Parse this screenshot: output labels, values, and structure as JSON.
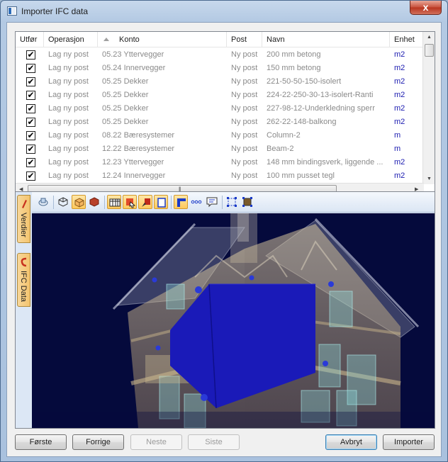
{
  "window": {
    "title": "Importer IFC data",
    "close_glyph": "x"
  },
  "grid": {
    "columns": [
      "Utfør",
      "Operasjon",
      "Konto",
      "Post",
      "Navn",
      "Enhet"
    ],
    "sorted_column": "Konto",
    "rows": [
      {
        "checked": true,
        "operasjon": "Lag ny post",
        "konto": "05.23 Yttervegger",
        "post": "Ny post",
        "navn": "200 mm betong",
        "enhet": "m2"
      },
      {
        "checked": true,
        "operasjon": "Lag ny post",
        "konto": "05.24 Innervegger",
        "post": "Ny post",
        "navn": "150 mm betong",
        "enhet": "m2"
      },
      {
        "checked": true,
        "operasjon": "Lag ny post",
        "konto": "05.25 Dekker",
        "post": "Ny post",
        "navn": "221-50-50-150-isolert",
        "enhet": "m2"
      },
      {
        "checked": true,
        "operasjon": "Lag ny post",
        "konto": "05.25 Dekker",
        "post": "Ny post",
        "navn": "224-22-250-30-13-isolert-Ranti",
        "enhet": "m2"
      },
      {
        "checked": true,
        "operasjon": "Lag ny post",
        "konto": "05.25 Dekker",
        "post": "Ny post",
        "navn": "227-98-12-Underkledning sperr",
        "enhet": "m2"
      },
      {
        "checked": true,
        "operasjon": "Lag ny post",
        "konto": "05.25 Dekker",
        "post": "Ny post",
        "navn": "262-22-148-balkong",
        "enhet": "m2"
      },
      {
        "checked": true,
        "operasjon": "Lag ny post",
        "konto": "08.22 Bæresystemer",
        "post": "Ny post",
        "navn": "Column-2",
        "enhet": "m"
      },
      {
        "checked": true,
        "operasjon": "Lag ny post",
        "konto": "12.22 Bæresystemer",
        "post": "Ny post",
        "navn": "Beam-2",
        "enhet": "m"
      },
      {
        "checked": true,
        "operasjon": "Lag ny post",
        "konto": "12.23 Yttervegger",
        "post": "Ny post",
        "navn": "148 mm bindingsverk, liggende ...",
        "enhet": "m2"
      },
      {
        "checked": true,
        "operasjon": "Lag ny post",
        "konto": "12.24 Innervegger",
        "post": "Ny post",
        "navn": "100 mm pusset tegl",
        "enhet": "m2"
      }
    ]
  },
  "viewer": {
    "side_tabs": [
      "Verdier",
      "IFC Data"
    ],
    "toolbar_icons": [
      "orbit-icon",
      "wireframe-icon",
      "transparent-icon",
      "solid-icon",
      "table-icon",
      "select-icon",
      "paint-icon",
      "frame-icon",
      "corner-icon",
      "dots-icon",
      "comment-icon",
      "select-region-icon",
      "fit-icon"
    ]
  },
  "buttons": {
    "forste": "Første",
    "forrige": "Forrige",
    "neste": "Neste",
    "siste": "Siste",
    "avbryt": "Avbryt",
    "importer": "Importer"
  },
  "colors": {
    "selected_object": "#1a1ab8",
    "scene_background": "#050a3c",
    "unit_text": "#1a1ab0"
  }
}
